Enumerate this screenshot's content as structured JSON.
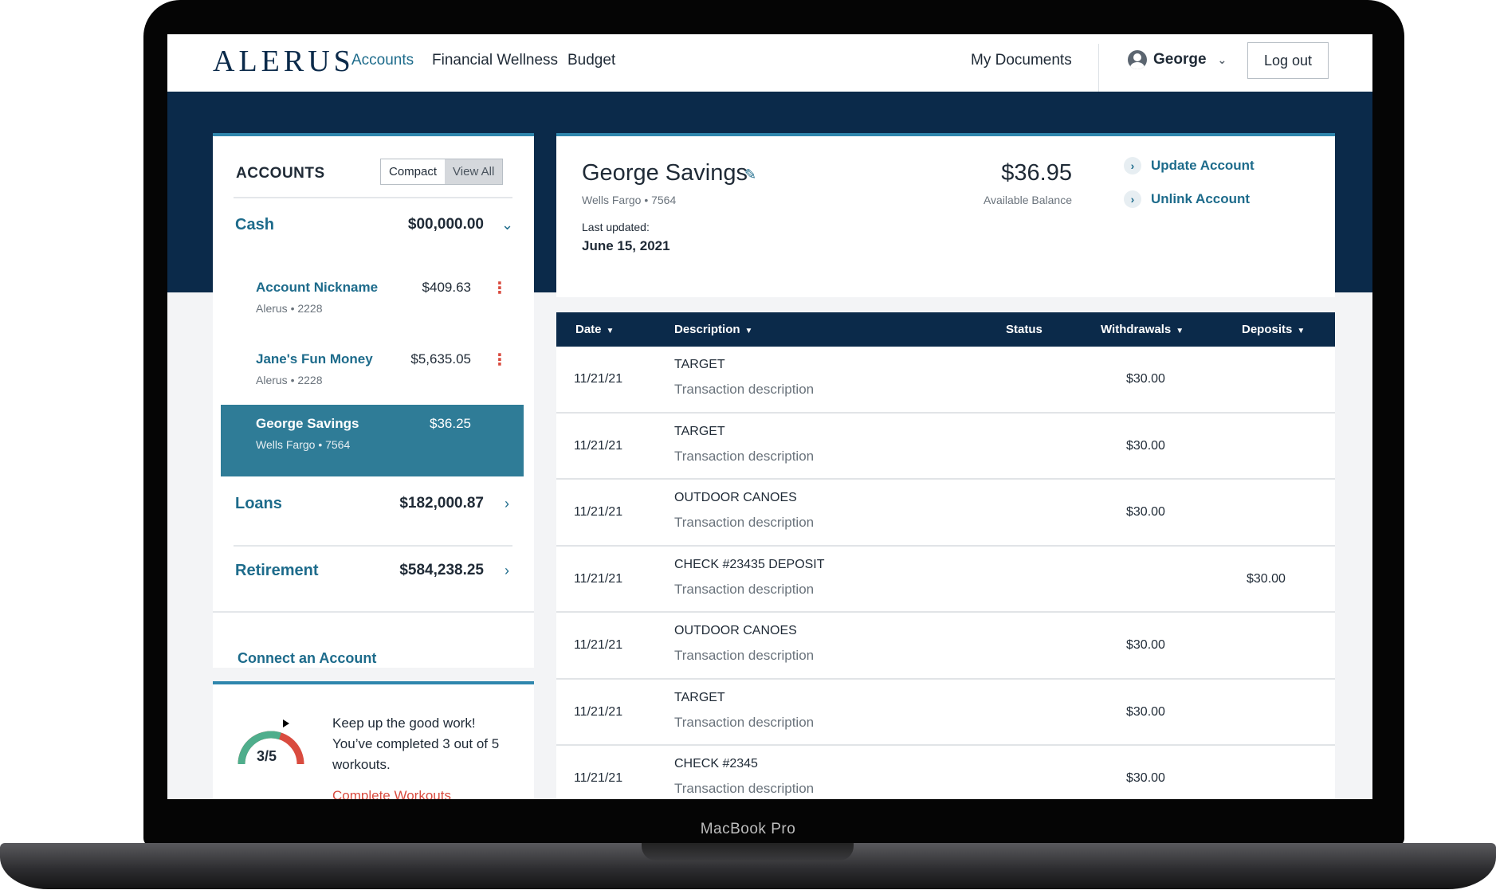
{
  "device": {
    "brand_label": "MacBook Pro"
  },
  "header": {
    "logo": "ALERUS",
    "nav": [
      "Accounts",
      "Financial Wellness",
      "Budget"
    ],
    "my_documents": "My Documents",
    "user_name": "George",
    "logout": "Log out"
  },
  "accounts_panel": {
    "title": "ACCOUNTS",
    "toggle": {
      "compact": "Compact",
      "view_all": "View All",
      "selected": "View All"
    },
    "cash": {
      "label": "Cash",
      "amount": "$00,000.00"
    },
    "accounts": [
      {
        "name": "Account Nickname",
        "amount": "$409.63",
        "sub": "Alerus • 2228"
      },
      {
        "name": "Jane's Fun Money",
        "amount": "$5,635.05",
        "sub": "Alerus • 2228"
      },
      {
        "name": "George Savings",
        "amount": "$36.25",
        "sub": "Wells Fargo • 7564"
      }
    ],
    "loans": {
      "label": "Loans",
      "amount": "$182,000.87"
    },
    "retirement": {
      "label": "Retirement",
      "amount": "$584,238.25"
    },
    "connect": "Connect an Account"
  },
  "workouts": {
    "progress_label": "3/5",
    "completed": 3,
    "total": 5,
    "line1": "Keep up the good work!",
    "line2": "You’ve completed 3 out of 5 workouts.",
    "link": "Complete Workouts"
  },
  "summary": {
    "account_name": "George Savings",
    "account_sub": "Wells Fargo • 7564",
    "updated_label": "Last updated:",
    "updated_date": "June 15, 2021",
    "balance": "$36.95",
    "balance_label": "Available Balance",
    "actions": [
      "Update Account",
      "Unlink Account"
    ]
  },
  "table": {
    "headers": {
      "date": "Date",
      "description": "Description",
      "status": "Status",
      "withdrawals": "Withdrawals",
      "deposits": "Deposits"
    },
    "rows": [
      {
        "date": "11/21/21",
        "description": "TARGET",
        "sub": "Transaction description",
        "withdrawal": "$30.00",
        "deposit": ""
      },
      {
        "date": "11/21/21",
        "description": "TARGET",
        "sub": "Transaction description",
        "withdrawal": "$30.00",
        "deposit": ""
      },
      {
        "date": "11/21/21",
        "description": "OUTDOOR CANOES",
        "sub": "Transaction description",
        "withdrawal": "$30.00",
        "deposit": ""
      },
      {
        "date": "11/21/21",
        "description": "CHECK #23435 DEPOSIT",
        "sub": "Transaction description",
        "withdrawal": "",
        "deposit": "$30.00"
      },
      {
        "date": "11/21/21",
        "description": "OUTDOOR CANOES",
        "sub": "Transaction description",
        "withdrawal": "$30.00",
        "deposit": ""
      },
      {
        "date": "11/21/21",
        "description": "TARGET",
        "sub": "Transaction description",
        "withdrawal": "$30.00",
        "deposit": ""
      },
      {
        "date": "11/21/21",
        "description": "CHECK #2345",
        "sub": "Transaction description",
        "withdrawal": "$30.00",
        "deposit": ""
      }
    ]
  },
  "colors": {
    "navy": "#0b2a4a",
    "teal": "#1d6b8b",
    "selected": "#2f7c97",
    "alert": "#d94b3f",
    "gauge_green": "#4fae8c"
  }
}
